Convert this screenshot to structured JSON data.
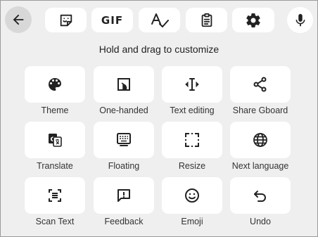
{
  "toolbar": {
    "back_icon": "arrow-back-icon",
    "buttons": [
      {
        "icon": "sticker-icon"
      },
      {
        "label": "GIF"
      },
      {
        "icon": "spellcheck-icon"
      },
      {
        "icon": "clipboard-icon"
      },
      {
        "icon": "gear-icon"
      }
    ],
    "mic_icon": "microphone-icon"
  },
  "title": "Hold and drag to customize",
  "tiles": [
    {
      "label": "Theme",
      "icon": "palette-icon"
    },
    {
      "label": "One-handed",
      "icon": "one-handed-icon"
    },
    {
      "label": "Text editing",
      "icon": "text-cursor-icon"
    },
    {
      "label": "Share Gboard",
      "icon": "share-icon"
    },
    {
      "label": "Translate",
      "icon": "translate-icon"
    },
    {
      "label": "Floating",
      "icon": "floating-keyboard-icon"
    },
    {
      "label": "Resize",
      "icon": "resize-icon"
    },
    {
      "label": "Next language",
      "icon": "globe-icon"
    },
    {
      "label": "Scan Text",
      "icon": "scan-text-icon"
    },
    {
      "label": "Feedback",
      "icon": "feedback-icon"
    },
    {
      "label": "Emoji",
      "icon": "emoji-icon"
    },
    {
      "label": "Undo",
      "icon": "undo-icon"
    }
  ],
  "colors": {
    "background": "#efefef",
    "tile": "#ffffff",
    "back_button": "#d8d8d8",
    "icon": "#222222"
  }
}
